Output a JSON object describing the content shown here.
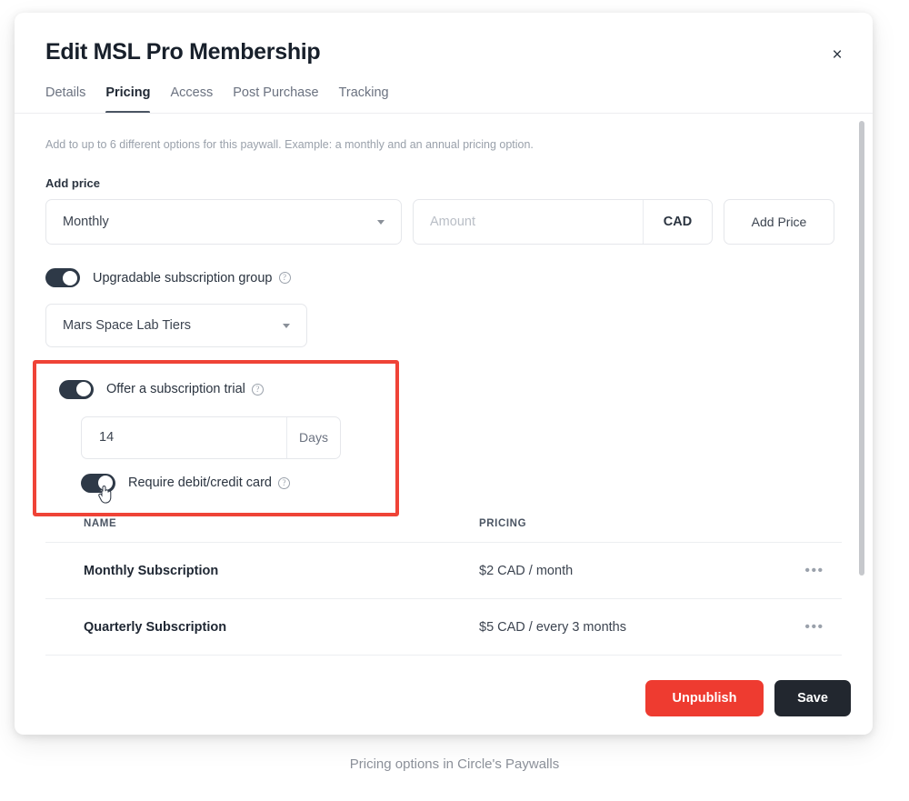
{
  "modal": {
    "title": "Edit MSL Pro Membership",
    "close_label": "×",
    "tabs": [
      {
        "label": "Details",
        "active": false
      },
      {
        "label": "Pricing",
        "active": true
      },
      {
        "label": "Access",
        "active": false
      },
      {
        "label": "Post Purchase",
        "active": false
      },
      {
        "label": "Tracking",
        "active": false
      }
    ]
  },
  "pricing": {
    "hint": "Add to up to 6 different options for this paywall. Example: a monthly and an annual pricing option.",
    "add_price_label": "Add price",
    "interval_value": "Monthly",
    "amount_value": "",
    "amount_placeholder": "Amount",
    "currency": "CAD",
    "add_price_button": "Add Price",
    "upgradable": {
      "label": "Upgradable subscription group",
      "info": "?",
      "enabled": true,
      "group_value": "Mars Space Lab Tiers"
    },
    "trial": {
      "label": "Offer a subscription trial",
      "info": "?",
      "enabled": true,
      "duration_value": "14",
      "duration_unit": "Days",
      "require_card": {
        "label": "Require debit/credit card",
        "info": "?",
        "enabled": true
      }
    }
  },
  "table": {
    "columns": {
      "name": "NAME",
      "pricing": "PRICING"
    },
    "menu_glyph": "•••",
    "rows": [
      {
        "name": "Monthly Subscription",
        "pricing": "$2 CAD / month"
      },
      {
        "name": "Quarterly Subscription",
        "pricing": "$5 CAD / every 3 months"
      }
    ]
  },
  "footer": {
    "unpublish_label": "Unpublish",
    "save_label": "Save"
  },
  "caption": "Pricing options in Circle's Paywalls",
  "colors": {
    "accent_red": "#ee3b30",
    "highlight_red": "#ef4337",
    "dark": "#22272f",
    "toggle_on": "#2e3947"
  }
}
